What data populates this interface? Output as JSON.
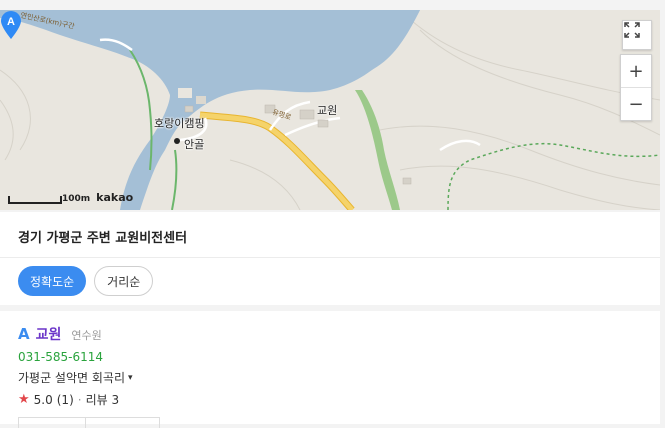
{
  "map": {
    "marker_letter": "A",
    "marker_label": "교원",
    "places": {
      "camping": "호랑이캠핑",
      "village": "안골"
    },
    "road_labels": {
      "upper": "연인산로(km)구간",
      "lower": "유명로"
    },
    "scale_text": "100m",
    "brand": "kakao",
    "controls": {
      "fullscreen_icon": "expand-icon",
      "zoom_in": "+",
      "zoom_out": "−"
    },
    "colors": {
      "water": "#a4bfd6",
      "land": "#e9e6df",
      "road": "#f0c34a",
      "green": "#9cc98a",
      "marker": "#2f8af5"
    }
  },
  "search": {
    "query": "경기 가평군 주변 교원비전센터"
  },
  "sort": {
    "accuracy": "정확도순",
    "distance": "거리순"
  },
  "result": {
    "letter": "A",
    "name": "교원",
    "category": "연수원",
    "phone": "031-585-6114",
    "address": "가평군 설악면 회곡리",
    "rating": "5.0",
    "rating_count": "(1)",
    "separator": "·",
    "review": "리뷰 3"
  }
}
